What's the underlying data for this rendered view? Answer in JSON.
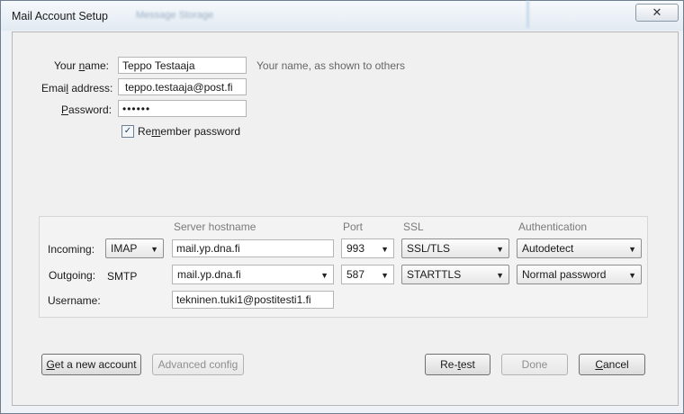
{
  "window": {
    "title": "Mail Account Setup",
    "background_title": "Message Storage",
    "close_glyph": "✕"
  },
  "form": {
    "name_label_pre": "Your ",
    "name_label_key": "n",
    "name_label_post": "ame:",
    "name_value": "Teppo Testaaja",
    "name_hint": "Your name, as shown to others",
    "email_label_pre": "Emai",
    "email_label_key": "l",
    "email_label_post": " address:",
    "email_value": "teppo.testaaja@post.fi",
    "password_label_key": "P",
    "password_label_post": "assword:",
    "password_value": "••••••",
    "remember_pre": "Re",
    "remember_key": "m",
    "remember_post": "ember password",
    "remember_checked": true,
    "check_glyph": "✓"
  },
  "server": {
    "headers": {
      "hostname": "Server hostname",
      "port": "Port",
      "ssl": "SSL",
      "auth": "Authentication"
    },
    "incoming": {
      "label": "Incoming:",
      "protocol": "IMAP",
      "hostname": "mail.yp.dna.fi",
      "port": "993",
      "ssl": "SSL/TLS",
      "auth": "Autodetect"
    },
    "outgoing": {
      "label": "Outgoing:",
      "protocol": "SMTP",
      "hostname": "mail.yp.dna.fi",
      "port": "587",
      "ssl": "STARTTLS",
      "auth": "Normal password"
    },
    "username": {
      "label": "Username:",
      "value": "tekninen.tuki1@postitesti1.fi"
    },
    "dropdown_glyph": "▼"
  },
  "buttons": {
    "get_account_key": "G",
    "get_account_post": "et a new account",
    "advanced": "Advanced config",
    "retest_pre": "Re-",
    "retest_key": "t",
    "retest_post": "est",
    "done": "Done",
    "cancel_key": "C",
    "cancel_post": "ancel"
  }
}
